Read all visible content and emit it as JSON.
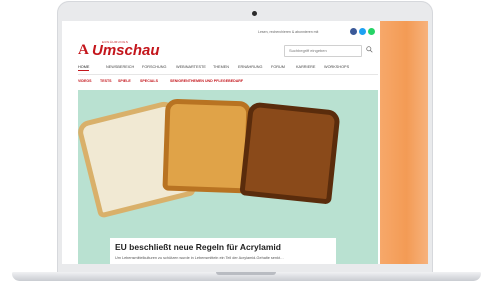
{
  "site": {
    "logo_text": "Umschau",
    "logo_sup": "ERNÄHRUNGS",
    "top_text": "Lesen, recherchieren & abonnieren mit",
    "search_placeholder": "Suchbegriff eingeben"
  },
  "nav": [
    {
      "label": "HOME"
    },
    {
      "label": "NEWSBEREICH"
    },
    {
      "label": "FORSCHUNG"
    },
    {
      "label": "WEBINARTESTE"
    },
    {
      "label": "THEMEN"
    },
    {
      "label": "ERNÄHRUNG"
    },
    {
      "label": "FORUM"
    },
    {
      "label": "KARRIERE"
    },
    {
      "label": "WORKSHOPS"
    }
  ],
  "subnav": [
    {
      "label": "VIDEOS"
    },
    {
      "label": "TESTS"
    },
    {
      "label": "SPIELE"
    },
    {
      "label": "SPECIALS"
    },
    {
      "label": "SENIORENTHEMEN UND PFLEGEBEDARF"
    }
  ],
  "article": {
    "headline": "EU beschließt neue Regeln für Acrylamid",
    "teaser": "Um Lebensmittelkulturen zu schützen wurde in Lebensmitteln ein Teil der Acrylamid-Gehalte senkt…"
  },
  "colors": {
    "brand_red": "#c4161c",
    "hero_bg": "#b9e1d1",
    "side_orange": "#f39b55"
  },
  "icons": [
    "facebook-icon",
    "twitter-icon",
    "whatsapp-icon",
    "search-icon"
  ]
}
